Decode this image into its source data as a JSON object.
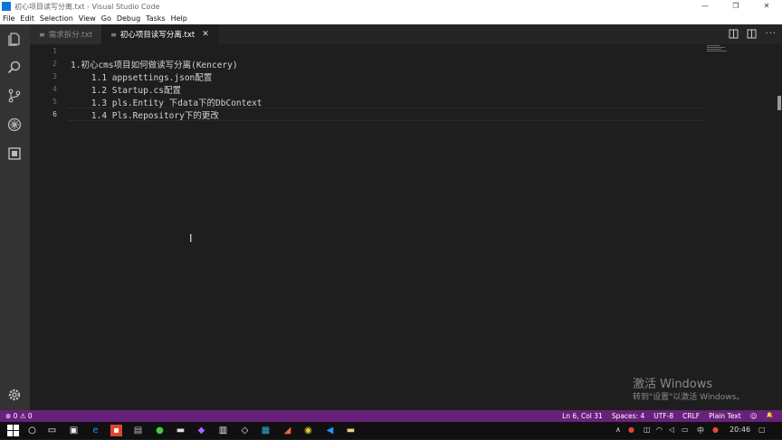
{
  "window": {
    "title": "初心项目读写分离.txt - Visual Studio Code",
    "min": "—",
    "max": "❐",
    "close": "✕"
  },
  "menu": [
    "File",
    "Edit",
    "Selection",
    "View",
    "Go",
    "Debug",
    "Tasks",
    "Help"
  ],
  "tabs": [
    {
      "label": "需求拆分.txt",
      "active": false
    },
    {
      "label": "初心项目读写分离.txt",
      "active": true,
      "close": "✕"
    }
  ],
  "editor": {
    "line_numbers": [
      "1",
      "2",
      "3",
      "4",
      "5",
      "6"
    ],
    "lines": [
      "",
      "1.初心cms项目如何做读写分离(Kencery)",
      "    1.1 appsettings.json配置",
      "    1.2 Startup.cs配置",
      "    1.3 pls.Entity 下data下的DbContext",
      "    1.4 Pls.Repository下的更改"
    ],
    "cursor_glyph": "I"
  },
  "statusbar": {
    "problems": "⊗ 0 ⚠ 0",
    "position": "Ln 6, Col 31",
    "spaces": "Spaces: 4",
    "encoding": "UTF-8",
    "eol": "CRLF",
    "language": "Plain Text",
    "smiley": "☺",
    "bell": "🔔"
  },
  "watermark": {
    "line1": "激活 Windows",
    "line2": "转到\"设置\"以激活 Windows。"
  },
  "taskbar": {
    "ime": "中",
    "time": "20:46"
  },
  "icons": {
    "activity": [
      "files-icon",
      "search-icon",
      "source-control-icon",
      "debug-icon",
      "extensions-icon",
      "settings-gear-icon"
    ],
    "tab_actions": [
      "split-compare-icon",
      "split-editor-icon",
      "more-icon"
    ]
  },
  "colors": {
    "statusbar": "#68217a",
    "editor_bg": "#1e1e1e",
    "activity_bg": "#333333"
  }
}
